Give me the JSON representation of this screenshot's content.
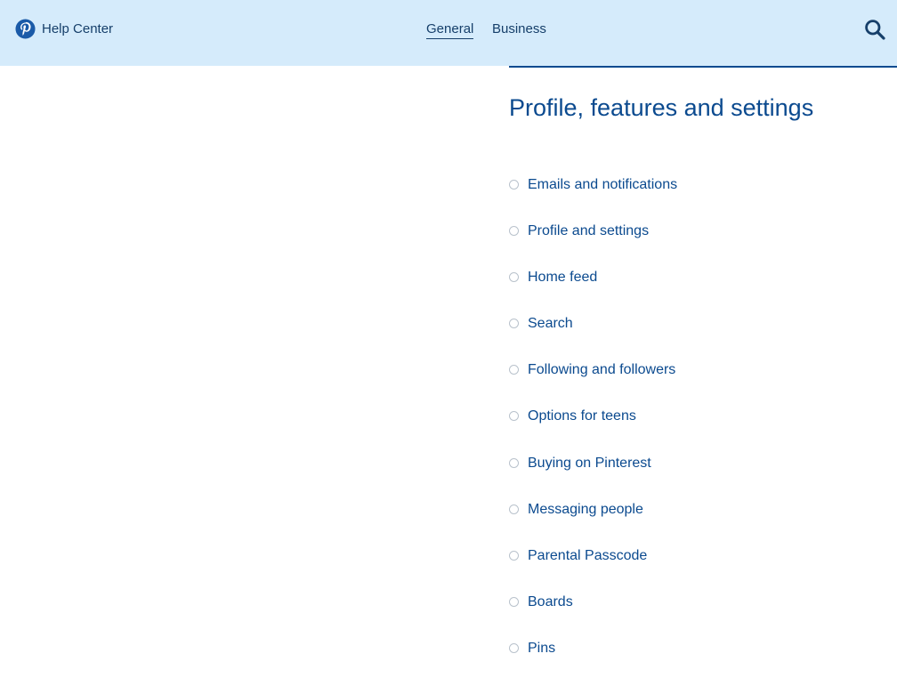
{
  "header": {
    "brand_label": "Help Center",
    "nav": {
      "general_label": "General",
      "business_label": "Business"
    },
    "search_icon": "search-icon",
    "logo_icon": "pinterest-logo-icon",
    "background_color": "#d5ebfb"
  },
  "main": {
    "title": "Profile, features and settings",
    "topics": [
      {
        "label": "Emails and notifications"
      },
      {
        "label": "Profile and settings"
      },
      {
        "label": "Home feed"
      },
      {
        "label": "Search"
      },
      {
        "label": "Following and followers"
      },
      {
        "label": "Options for teens"
      },
      {
        "label": "Buying on Pinterest"
      },
      {
        "label": "Messaging people"
      },
      {
        "label": "Parental Passcode"
      },
      {
        "label": "Boards"
      },
      {
        "label": "Pins"
      }
    ]
  },
  "colors": {
    "accent": "#0b4a8f",
    "header_text": "#163f6a"
  }
}
